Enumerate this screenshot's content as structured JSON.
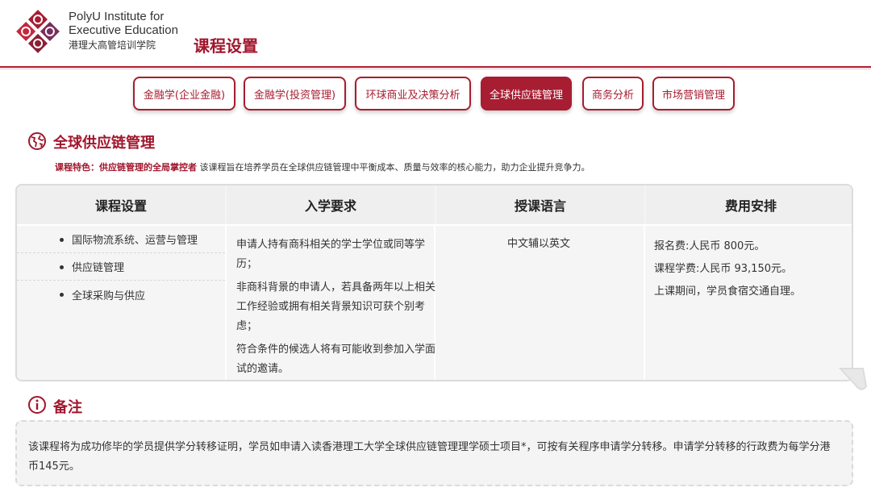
{
  "header": {
    "org_line1": "PolyU Institute for",
    "org_line2": "Executive Education",
    "org_line3": "港理大高管培训学院",
    "page_title": "课程设置",
    "logo_icon": "polyu-logo-icon",
    "brand_color": "#a71d31"
  },
  "tabs": [
    {
      "label": "金融学(企业金融)",
      "active": false
    },
    {
      "label": "金融学(投资管理)",
      "active": false
    },
    {
      "label": "环球商业及决策分析",
      "active": false
    },
    {
      "label": "全球供应链管理",
      "active": true
    },
    {
      "label": "商务分析",
      "active": false
    },
    {
      "label": "市场营销管理",
      "active": false
    }
  ],
  "section": {
    "icon": "globe-icon",
    "title": "全球供应链管理",
    "feature_label": "课程特色：供应链管理的全局掌控者",
    "feature_text": "该课程旨在培养学员在全球供应链管理中平衡成本、质量与效率的核心能力，助力企业提升竞争力。"
  },
  "table": {
    "headers": [
      "课程设置",
      "入学要求",
      "授课语言",
      "费用安排"
    ],
    "courses": [
      "国际物流系统、运营与管理",
      "供应链管理",
      "全球采购与供应"
    ],
    "requirements": [
      "申请人持有商科相关的学士学位或同等学历；",
      "非商科背景的申请人，若具备两年以上相关工作经验或拥有相关背景知识可获个别考虑；",
      "符合条件的候选人将有可能收到参加入学面试的邀请。"
    ],
    "language": "中文辅以英文",
    "fees": [
      "报名费:人民币 800元。",
      "课程学费:人民币 93,150元。",
      "上课期间，学员食宿交通自理。"
    ]
  },
  "notes": {
    "icon": "info-icon",
    "title": "备注",
    "text": "该课程将为成功修毕的学员提供学分转移证明，学员如申请入读香港理工大学全球供应链管理理学硕士项目*，可按有关程序申请学分转移。申请学分转移的行政费为每学分港币145元。"
  }
}
